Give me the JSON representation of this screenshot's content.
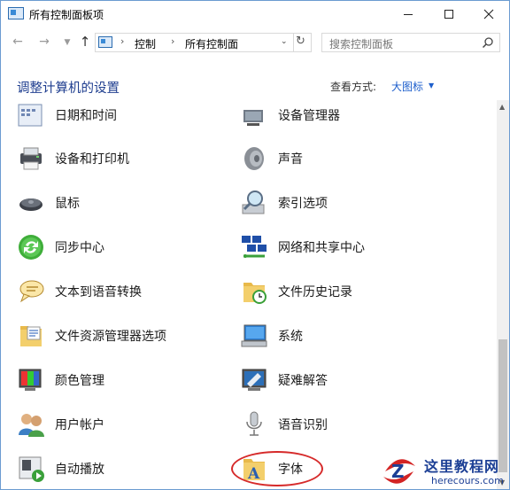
{
  "window": {
    "title": "所有控制面板项",
    "controls": {
      "minimize": "minimize",
      "maximize": "maximize",
      "close": "close"
    }
  },
  "navigation": {
    "breadcrumbs": [
      "控制",
      "所有控制面"
    ],
    "search_placeholder": "搜索控制面板"
  },
  "header": {
    "title": "调整计算机的设置",
    "view_label": "查看方式:",
    "view_value": "大图标"
  },
  "items": [
    {
      "label": "日期和时间",
      "icon": "clock-icon",
      "column": "left"
    },
    {
      "label": "设备管理器",
      "icon": "device-manager-icon",
      "column": "right"
    },
    {
      "label": "设备和打印机",
      "icon": "printer-icon",
      "column": "left"
    },
    {
      "label": "声音",
      "icon": "speaker-icon",
      "column": "right"
    },
    {
      "label": "鼠标",
      "icon": "mouse-icon",
      "column": "left"
    },
    {
      "label": "索引选项",
      "icon": "indexing-icon",
      "column": "right"
    },
    {
      "label": "同步中心",
      "icon": "sync-icon",
      "column": "left"
    },
    {
      "label": "网络和共享中心",
      "icon": "network-icon",
      "column": "right"
    },
    {
      "label": "文本到语音转换",
      "icon": "speech-bubble-icon",
      "column": "left"
    },
    {
      "label": "文件历史记录",
      "icon": "file-history-icon",
      "column": "right"
    },
    {
      "label": "文件资源管理器选项",
      "icon": "folder-options-icon",
      "column": "left"
    },
    {
      "label": "系统",
      "icon": "system-icon",
      "column": "right"
    },
    {
      "label": "颜色管理",
      "icon": "color-management-icon",
      "column": "left"
    },
    {
      "label": "疑难解答",
      "icon": "troubleshoot-icon",
      "column": "right"
    },
    {
      "label": "用户帐户",
      "icon": "user-accounts-icon",
      "column": "left"
    },
    {
      "label": "语音识别",
      "icon": "microphone-icon",
      "column": "right"
    },
    {
      "label": "自动播放",
      "icon": "autoplay-icon",
      "column": "left"
    },
    {
      "label": "字体",
      "icon": "fonts-icon",
      "column": "right"
    }
  ],
  "watermark": {
    "title": "这里教程网",
    "url": "herecours.com"
  },
  "colors": {
    "heading": "#1e3d8f",
    "link": "#1e5fcc",
    "highlight": "#d62a2a"
  }
}
